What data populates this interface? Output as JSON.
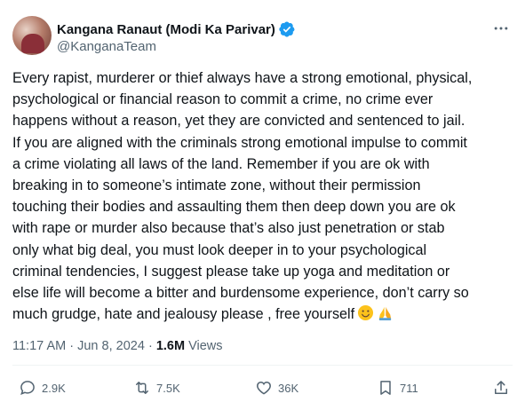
{
  "author": {
    "display_name": "Kangana Ranaut (Modi Ka Parivar)",
    "handle": "@KanganaTeam",
    "verified_color": "#1d9bf0"
  },
  "post": {
    "text": "Every rapist, murderer or thief always have a strong emotional, physical,\npsychological or financial reason to commit a crime, no crime ever\nhappens without a reason, yet they are convicted and sentenced to jail.\nIf you are aligned with the criminals strong emotional impulse to commit\na crime violating all laws of the land. Remember if you are ok with\nbreaking in to someone’s intimate zone, without their permission\ntouching their bodies and assaulting them then deep down you are ok\nwith rape or murder also because that’s also just penetration or stab\nonly what big deal, you must look deeper in to your psychological\ncriminal tendencies, I suggest please take up yoga and meditation or\nelse life will become a bitter and burdensome experience, don’t carry so\nmuch grudge, hate and jealousy please , free yourself",
    "emojis": [
      "smiling-face",
      "folded-hands"
    ]
  },
  "meta": {
    "time": "11:17 AM",
    "separator": "·",
    "date": "Jun 8, 2024",
    "views_count": "1.6M",
    "views_label": "Views"
  },
  "actions": {
    "replies": "2.9K",
    "reposts": "7.5K",
    "likes": "36K",
    "bookmarks": "711"
  },
  "colors": {
    "text": "#0f1419",
    "secondary": "#536471",
    "divider": "#eff3f4"
  },
  "icons": [
    "more-icon",
    "reply-icon",
    "repost-icon",
    "like-icon",
    "bookmark-icon",
    "share-icon",
    "verified-badge-icon"
  ]
}
